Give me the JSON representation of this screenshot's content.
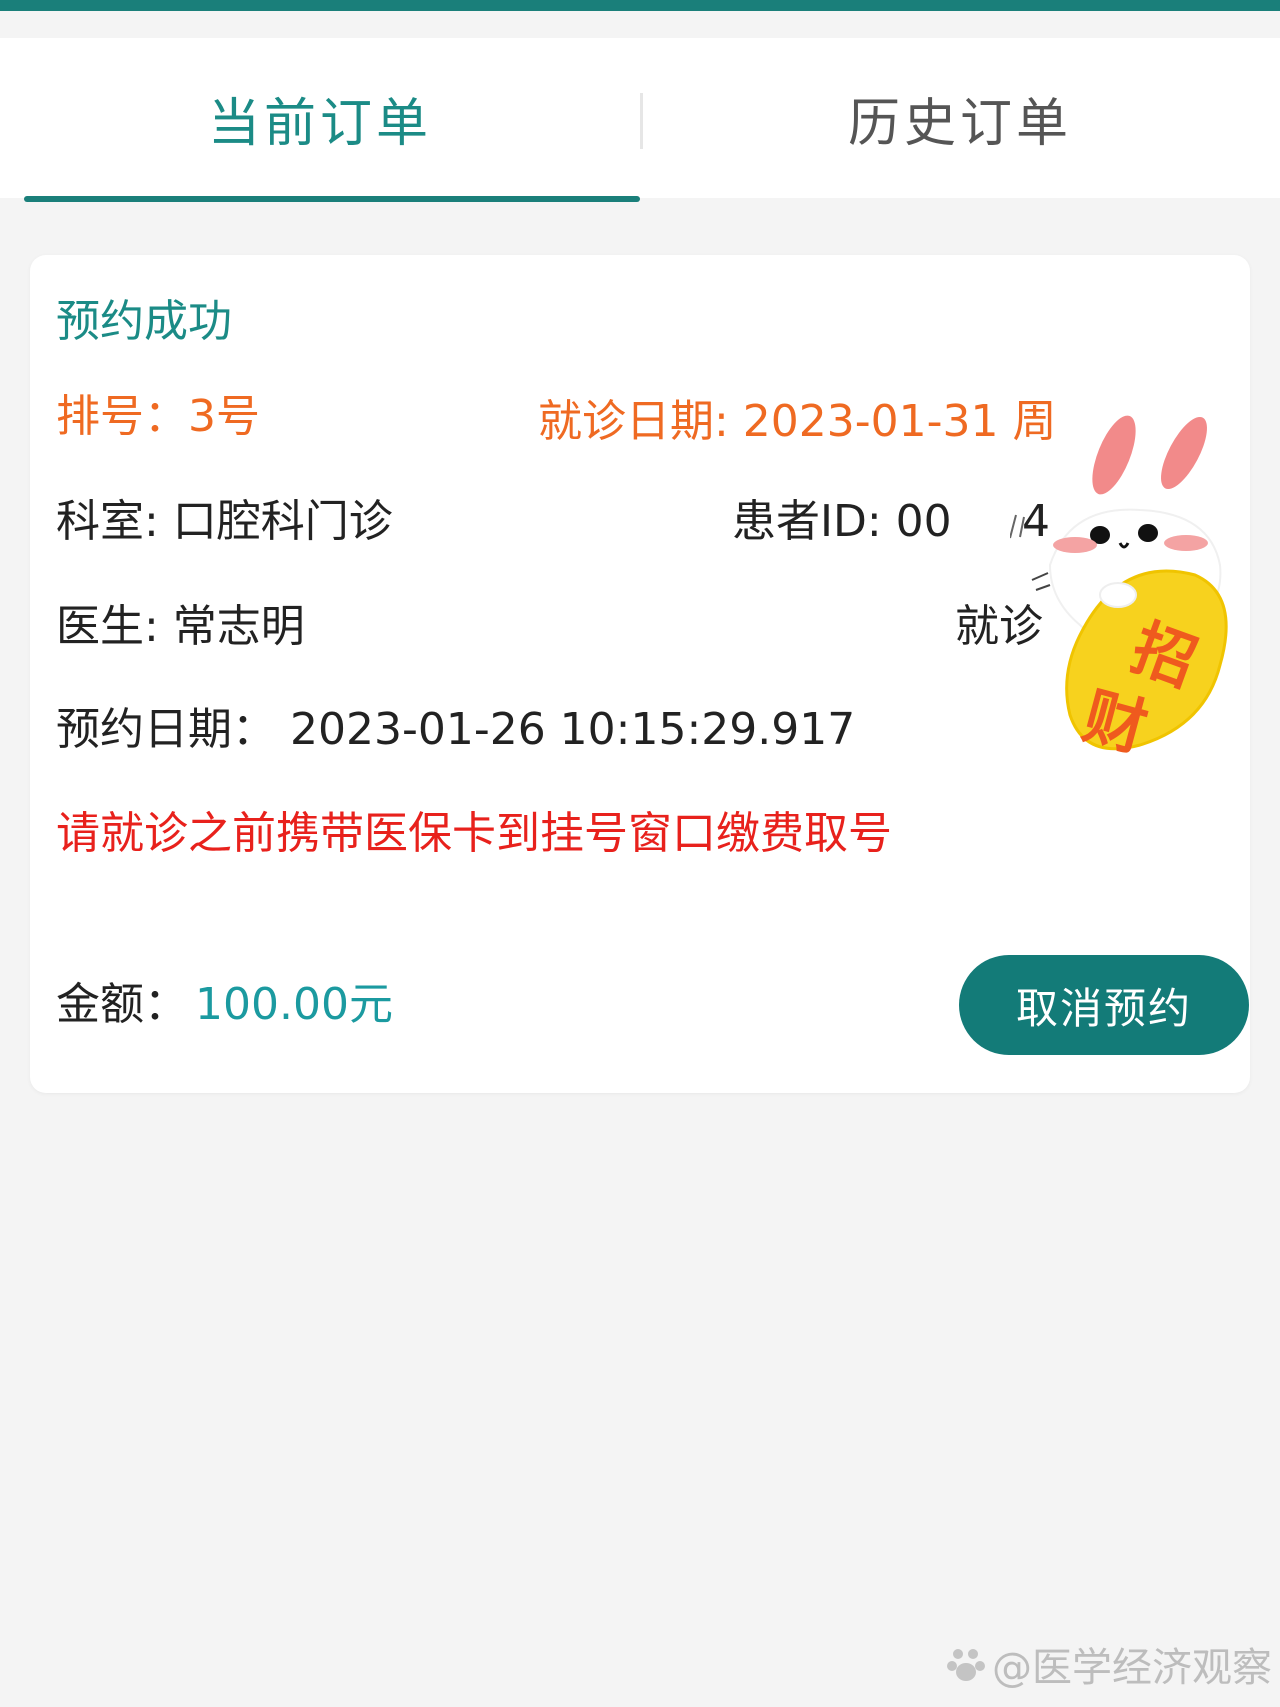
{
  "tabs": {
    "current_label": "当前订单",
    "history_label": "历史订单"
  },
  "order": {
    "status": "预约成功",
    "queue_number": "排号：3号",
    "visit_date": "就诊日期: 2023-01-31 周",
    "department": "科室: 口腔科门诊",
    "patient_id": "患者ID: 00",
    "patient_id_partial": "4",
    "doctor": "医生: 常志明",
    "visit_partial": "就诊",
    "booking_date": "预约日期：  2023-01-26 10:15:29.917",
    "notice": "请就诊之前携带医保卡到挂号窗口缴费取号",
    "amount_label": "金额：",
    "amount_value": "100.00元",
    "cancel_label": "取消预约"
  },
  "sticker": {
    "text_top": "招",
    "text_bottom": "财"
  },
  "watermark": {
    "text": "@医学经济观察"
  },
  "colors": {
    "accent": "#1a7f7a",
    "orange": "#ef6a22",
    "red": "#e8211c",
    "amount": "#1b9aa0"
  }
}
